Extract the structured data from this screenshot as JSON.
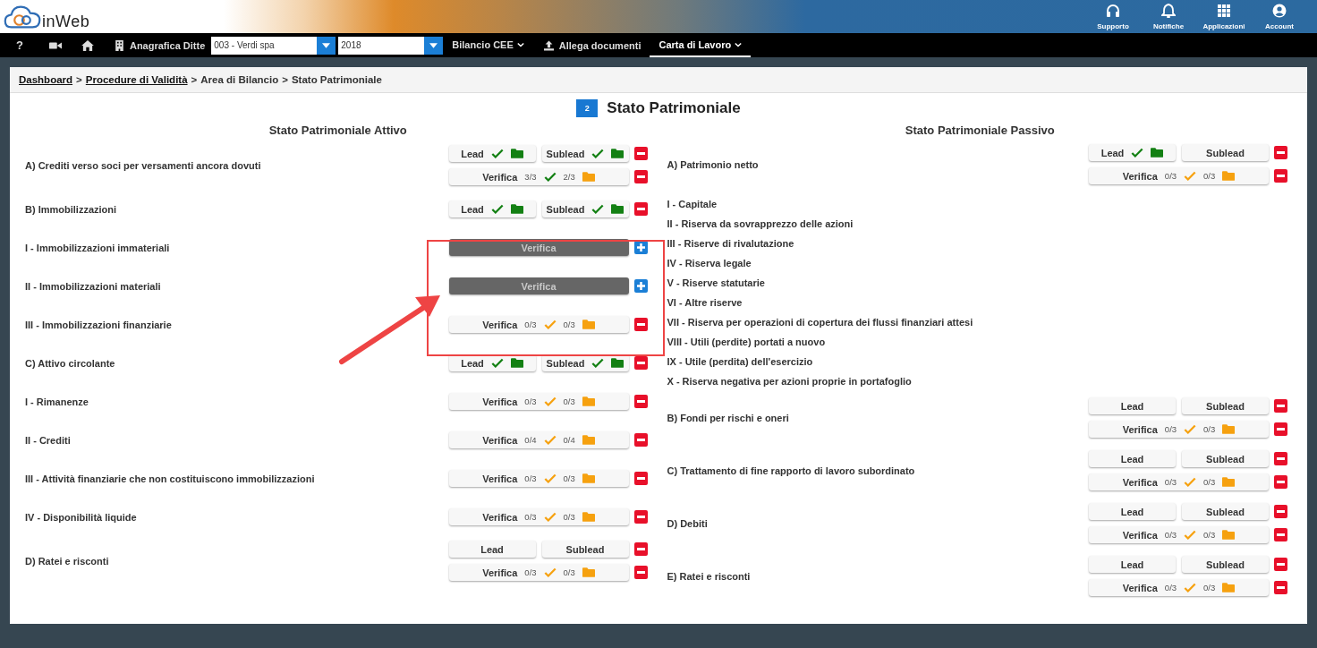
{
  "header": {
    "logo_text": "inWeb",
    "actions": [
      {
        "kind": "support",
        "label": "Supporto"
      },
      {
        "kind": "bell",
        "label": "Notifiche"
      },
      {
        "kind": "apps",
        "label": "Applicazioni"
      },
      {
        "kind": "account",
        "label": "Account"
      }
    ]
  },
  "navbar": {
    "items": [
      {
        "kind": "text",
        "label": "?"
      },
      {
        "kind": "video"
      },
      {
        "kind": "home"
      },
      {
        "kind": "building-link",
        "label": "Anagrafica Ditte"
      },
      {
        "kind": "select",
        "value": "003 - Verdi spa"
      },
      {
        "kind": "select",
        "value": "2018"
      },
      {
        "kind": "menu",
        "label": "Bilancio CEE",
        "selected": false
      },
      {
        "kind": "upload-link",
        "label": "Allega documenti"
      },
      {
        "kind": "menu",
        "label": "Carta di Lavoro",
        "selected": true
      }
    ]
  },
  "breadcrumb": [
    {
      "label": "Dashboard",
      "link": true
    },
    {
      "separator": ">",
      "label": "Procedure di Validità",
      "link": true
    },
    {
      "separator": ">",
      "label": "Area di Bilancio",
      "link": false
    },
    {
      "separator": ">",
      "label": "Stato Patrimoniale",
      "link": false
    }
  ],
  "title": {
    "badge": "2",
    "text": "Stato Patrimoniale"
  },
  "columns": [
    {
      "title": "Stato Patrimoniale Attivo",
      "rows": [
        {
          "label": "A) Crediti verso soci per versamenti ancora dovuti",
          "lines": [
            {
              "kind": "lead",
              "lead": {
                "label": "Lead",
                "done": true
              },
              "sublead": {
                "label": "Sublead",
                "done": true
              },
              "expanded": true
            },
            {
              "kind": "verifica",
              "label": "Verifica",
              "disabled": false,
              "count_a": "3/3",
              "check_done": true,
              "count_b": "2/3",
              "folder_done": false,
              "expanded": true
            }
          ]
        },
        {
          "label": "B) Immobilizzazioni",
          "lines": [
            {
              "kind": "lead",
              "lead": {
                "label": "Lead",
                "done": true
              },
              "sublead": {
                "label": "Sublead",
                "done": true
              },
              "expanded": true
            }
          ]
        },
        {
          "label": "I - Immobilizzazioni immateriali",
          "lines": [
            {
              "kind": "verifica",
              "label": "Verifica",
              "disabled": true,
              "expanded": false
            }
          ]
        },
        {
          "label": "II - Immobilizzazioni materiali",
          "lines": [
            {
              "kind": "verifica",
              "label": "Verifica",
              "disabled": true,
              "expanded": false
            }
          ]
        },
        {
          "label": "III - Immobilizzazioni finanziarie",
          "lines": [
            {
              "kind": "verifica",
              "label": "Verifica",
              "disabled": false,
              "count_a": "0/3",
              "check_done": false,
              "count_b": "0/3",
              "folder_done": false,
              "expanded": true
            }
          ]
        },
        {
          "label": "C) Attivo circolante",
          "lines": [
            {
              "kind": "lead",
              "lead": {
                "label": "Lead",
                "done": true
              },
              "sublead": {
                "label": "Sublead",
                "done": true
              },
              "expanded": true
            }
          ]
        },
        {
          "label": "I - Rimanenze",
          "lines": [
            {
              "kind": "verifica",
              "label": "Verifica",
              "disabled": false,
              "count_a": "0/3",
              "check_done": false,
              "count_b": "0/3",
              "folder_done": false,
              "expanded": true
            }
          ]
        },
        {
          "label": "II - Crediti",
          "lines": [
            {
              "kind": "verifica",
              "label": "Verifica",
              "disabled": false,
              "count_a": "0/4",
              "check_done": false,
              "count_b": "0/4",
              "folder_done": false,
              "expanded": true
            }
          ]
        },
        {
          "label": "III - Attività finanziarie che non costituiscono immobilizzazioni",
          "lines": [
            {
              "kind": "verifica",
              "label": "Verifica",
              "disabled": false,
              "count_a": "0/3",
              "check_done": false,
              "count_b": "0/3",
              "folder_done": false,
              "expanded": true
            }
          ]
        },
        {
          "label": "IV - Disponibilità liquide",
          "lines": [
            {
              "kind": "verifica",
              "label": "Verifica",
              "disabled": false,
              "count_a": "0/3",
              "check_done": false,
              "count_b": "0/3",
              "folder_done": false,
              "expanded": true
            }
          ]
        },
        {
          "label": "D) Ratei e risconti",
          "lines": [
            {
              "kind": "lead",
              "lead": {
                "label": "Lead",
                "done": false
              },
              "sublead": {
                "label": "Sublead",
                "done": false
              },
              "expanded": true
            },
            {
              "kind": "verifica",
              "label": "Verifica",
              "disabled": false,
              "count_a": "0/3",
              "check_done": false,
              "count_b": "0/3",
              "folder_done": false,
              "expanded": true
            }
          ]
        }
      ]
    },
    {
      "title": "Stato Patrimoniale Passivo",
      "rows": [
        {
          "label": "A) Patrimonio netto",
          "lines": [
            {
              "kind": "lead",
              "lead": {
                "label": "Lead",
                "done": true
              },
              "sublead": {
                "label": "Sublead",
                "done": false
              },
              "expanded": true
            },
            {
              "kind": "verifica",
              "label": "Verifica",
              "disabled": false,
              "count_a": "0/3",
              "check_done": false,
              "count_b": "0/3",
              "folder_done": false,
              "expanded": true
            }
          ]
        },
        {
          "label": "I - Capitale"
        },
        {
          "label": "II - Riserva da sovrapprezzo delle azioni"
        },
        {
          "label": "III - Riserve di rivalutazione"
        },
        {
          "label": "IV - Riserva legale"
        },
        {
          "label": "V - Riserve statutarie"
        },
        {
          "label": "VI - Altre riserve"
        },
        {
          "label": "VII - Riserva per operazioni di copertura dei flussi finanziari attesi"
        },
        {
          "label": "VIII - Utili (perdite) portati a nuovo"
        },
        {
          "label": "IX - Utile (perdita) dell'esercizio"
        },
        {
          "label": "X - Riserva negativa per azioni proprie in portafoglio"
        },
        {
          "label": "B) Fondi per rischi e oneri",
          "lines": [
            {
              "kind": "lead",
              "lead": {
                "label": "Lead",
                "done": false
              },
              "sublead": {
                "label": "Sublead",
                "done": false
              },
              "expanded": true
            },
            {
              "kind": "verifica",
              "label": "Verifica",
              "disabled": false,
              "count_a": "0/3",
              "check_done": false,
              "count_b": "0/3",
              "folder_done": false,
              "expanded": true
            }
          ]
        },
        {
          "label": "C) Trattamento di fine rapporto di lavoro subordinato",
          "lines": [
            {
              "kind": "lead",
              "lead": {
                "label": "Lead",
                "done": false
              },
              "sublead": {
                "label": "Sublead",
                "done": false
              },
              "expanded": true
            },
            {
              "kind": "verifica",
              "label": "Verifica",
              "disabled": false,
              "count_a": "0/3",
              "check_done": false,
              "count_b": "0/3",
              "folder_done": false,
              "expanded": true
            }
          ]
        },
        {
          "label": "D) Debiti",
          "lines": [
            {
              "kind": "lead",
              "lead": {
                "label": "Lead",
                "done": false
              },
              "sublead": {
                "label": "Sublead",
                "done": false
              },
              "expanded": true
            },
            {
              "kind": "verifica",
              "label": "Verifica",
              "disabled": false,
              "count_a": "0/3",
              "check_done": false,
              "count_b": "0/3",
              "folder_done": false,
              "expanded": true
            }
          ]
        },
        {
          "label": "E) Ratei e risconti",
          "lines": [
            {
              "kind": "lead",
              "lead": {
                "label": "Lead",
                "done": false
              },
              "sublead": {
                "label": "Sublead",
                "done": false
              },
              "expanded": true
            },
            {
              "kind": "verifica",
              "label": "Verifica",
              "disabled": false,
              "count_a": "0/3",
              "check_done": false,
              "count_b": "0/3",
              "folder_done": false,
              "expanded": true
            }
          ]
        }
      ]
    }
  ]
}
